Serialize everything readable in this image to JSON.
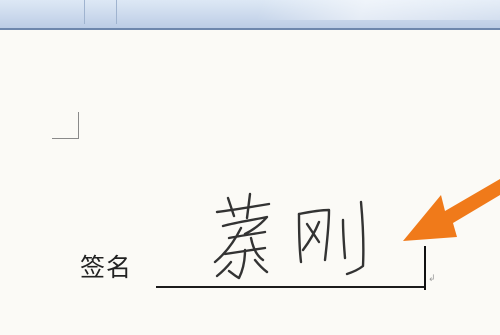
{
  "document": {
    "signature_label": "签名",
    "signature_text": "蔡刚",
    "paragraph_mark": "↲"
  },
  "colors": {
    "arrow": "#f07a1a",
    "ink": "#333333",
    "ribbon": "#c9d7ec"
  },
  "icons": {
    "annotation": "orange-arrow-icon",
    "margin": "margin-corner-mark"
  }
}
